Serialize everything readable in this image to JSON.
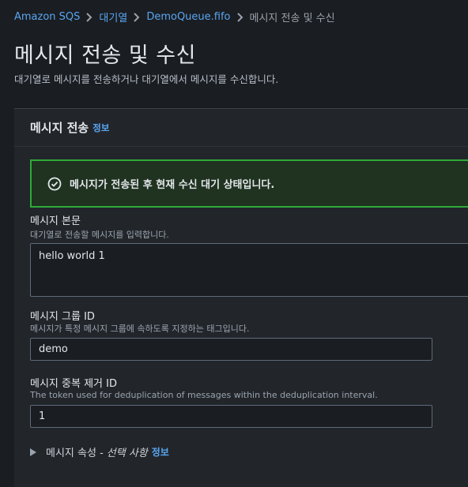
{
  "breadcrumb": {
    "items": [
      "Amazon SQS",
      "대기열",
      "DemoQueue.fifo"
    ],
    "current": "메시지 전송 및 수신"
  },
  "page": {
    "title": "메시지 전송 및 수신",
    "description": "대기열로 메시지를 전송하거나 대기열에서 메시지를 수신합니다."
  },
  "send_panel": {
    "title": "메시지 전송",
    "info_label": "정보",
    "alert": {
      "icon": "check-circle-icon",
      "text": "메시지가 전송된 후 현재 수신 대기 상태입니다.",
      "color": "#2fa93a"
    },
    "body_field": {
      "label": "메시지 본문",
      "description": "대기열로 전송할 메시지를 입력합니다.",
      "value": "hello world 1"
    },
    "group_id_field": {
      "label": "메시지 그룹 ID",
      "description": "메시지가 특정 메시지 그룹에 속하도록 지정하는 태그입니다.",
      "value": "demo"
    },
    "dedup_id_field": {
      "label": "메시지 중복 제거 ID",
      "description": "The token used for deduplication of messages within the deduplication interval.",
      "value": "1"
    },
    "attributes": {
      "label": "메시지 속성 -",
      "optional": "선택 사항",
      "info_label": "정보"
    }
  },
  "colors": {
    "link": "#59a6f2",
    "success": "#2fa93a",
    "background": "#1a1d21",
    "panel": "#22262b"
  }
}
